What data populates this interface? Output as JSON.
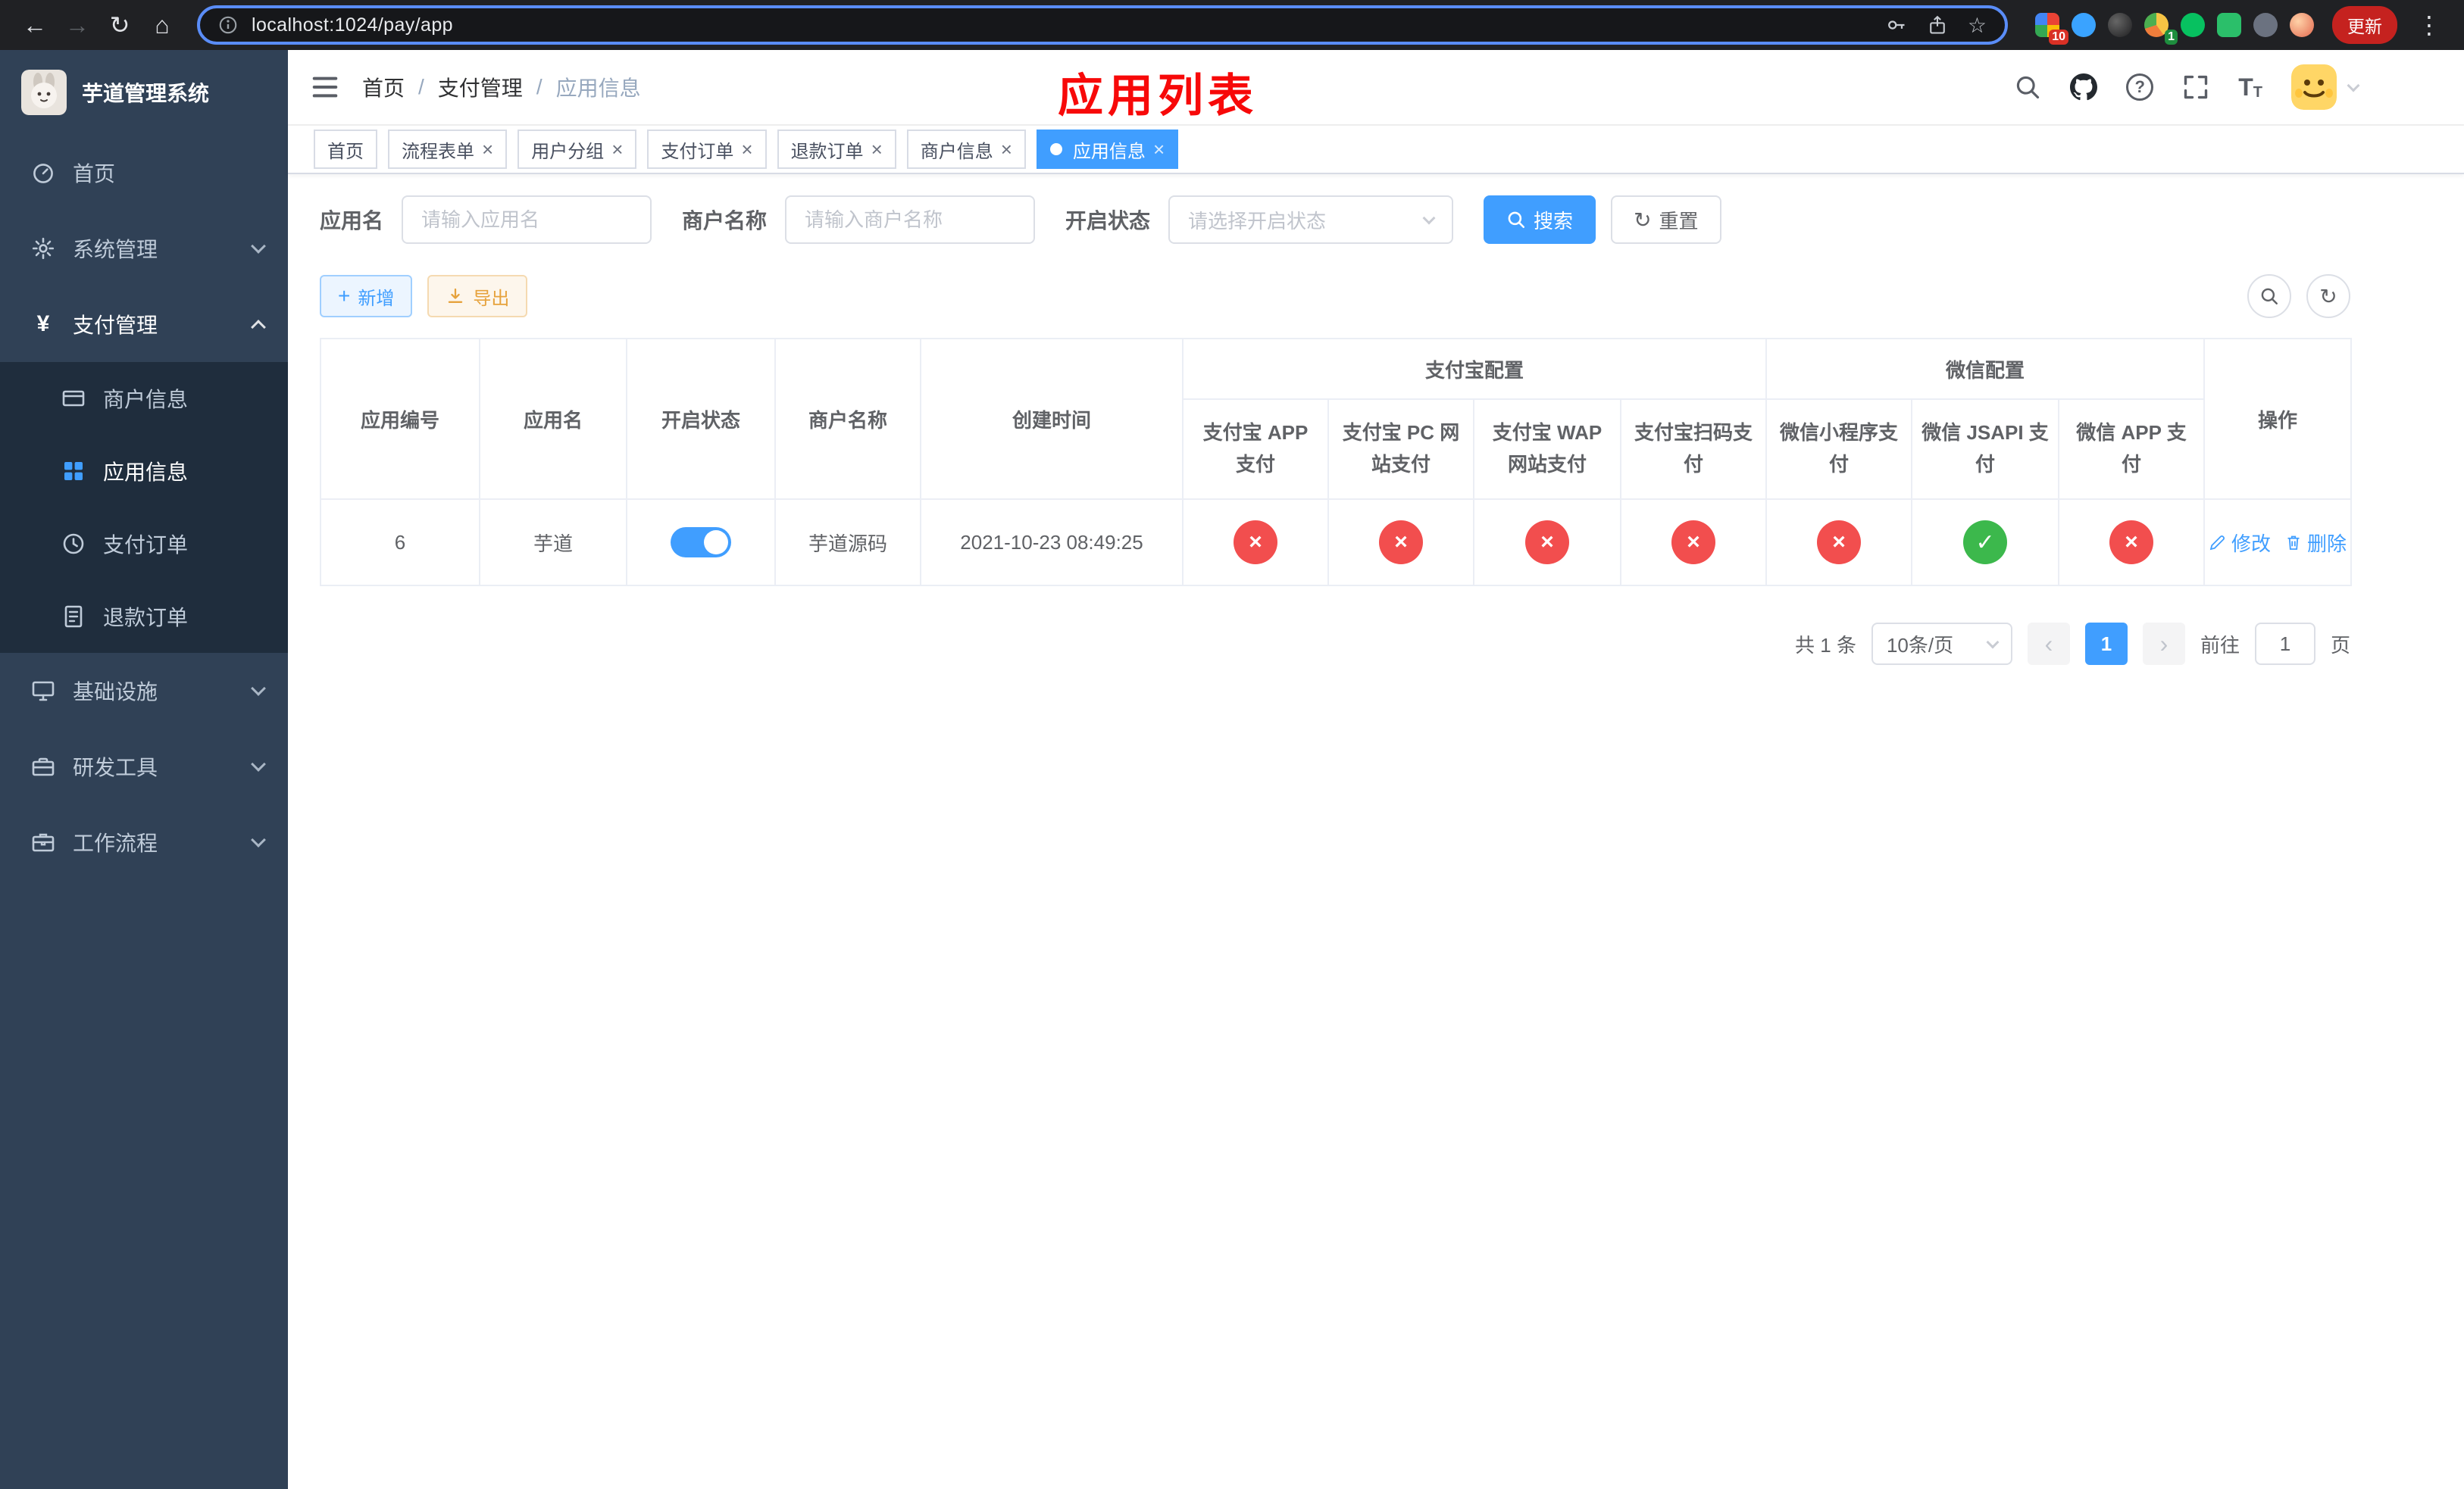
{
  "browser": {
    "url": "localhost:1024/pay/app",
    "update_label": "更新",
    "ext_badge_1": "10",
    "ext_badge_2": "1"
  },
  "icons": {
    "back": "←",
    "forward": "→",
    "reload": "↻",
    "home": "⌂",
    "star": "☆",
    "overflow": "⋮",
    "close": "×",
    "check": "✓",
    "cross": "×",
    "yen": "¥",
    "plus": "+",
    "refresh": "↻",
    "prev": "‹",
    "next": "›",
    "question": "?",
    "font_big": "T",
    "font_small": "T"
  },
  "colors": {
    "accent": "#409eff",
    "success": "#3cb84c",
    "danger": "#f24e4e",
    "sidebar_bg": "#304156",
    "submenu_bg": "#1f2d3d",
    "annotation_red": "#f70909"
  },
  "sidebar": {
    "logo_title": "芋道管理系统",
    "items": [
      {
        "label": "首页"
      },
      {
        "label": "系统管理"
      },
      {
        "label": "支付管理"
      },
      {
        "label": "基础设施"
      },
      {
        "label": "研发工具"
      },
      {
        "label": "工作流程"
      }
    ],
    "submenu": [
      {
        "label": "商户信息"
      },
      {
        "label": "应用信息"
      },
      {
        "label": "支付订单"
      },
      {
        "label": "退款订单"
      }
    ]
  },
  "header": {
    "breadcrumb": [
      "首页",
      "支付管理",
      "应用信息"
    ],
    "separator": "/",
    "overlay_title": "应用列表"
  },
  "tabs": [
    {
      "label": "首页"
    },
    {
      "label": "流程表单"
    },
    {
      "label": "用户分组"
    },
    {
      "label": "支付订单"
    },
    {
      "label": "退款订单"
    },
    {
      "label": "商户信息"
    },
    {
      "label": "应用信息"
    }
  ],
  "filters": {
    "app_name_label": "应用名",
    "app_name_placeholder": "请输入应用名",
    "merchant_name_label": "商户名称",
    "merchant_name_placeholder": "请输入商户名称",
    "status_label": "开启状态",
    "status_placeholder": "请选择开启状态",
    "search_button": "搜索",
    "reset_button": "重置"
  },
  "toolbar": {
    "add_button": "新增",
    "export_button": "导出"
  },
  "table": {
    "headers": {
      "app_id": "应用编号",
      "app_name": "应用名",
      "status": "开启状态",
      "merchant_name": "商户名称",
      "create_time": "创建时间",
      "alipay_group": "支付宝配置",
      "wechat_group": "微信配置",
      "operations": "操作",
      "alipay_cols": [
        "支付宝 APP 支付",
        "支付宝 PC 网站支付",
        "支付宝 WAP 网站支付",
        "支付宝扫码支付"
      ],
      "wechat_cols": [
        "微信小程序支付",
        "微信 JSAPI 支付",
        "微信 APP 支付"
      ]
    },
    "rows": [
      {
        "app_id": "6",
        "app_name": "芋道",
        "status": true,
        "merchant_name": "芋道源码",
        "create_time": "2021-10-23 08:49:25",
        "pay_configs": [
          false,
          false,
          false,
          false,
          false,
          true,
          false
        ],
        "edit_label": "修改",
        "delete_label": "删除"
      }
    ]
  },
  "pagination": {
    "total_text": "共 1 条",
    "page_size": "10条/页",
    "current_page": "1",
    "goto_prefix": "前往",
    "goto_suffix": "页",
    "goto_value": "1"
  }
}
